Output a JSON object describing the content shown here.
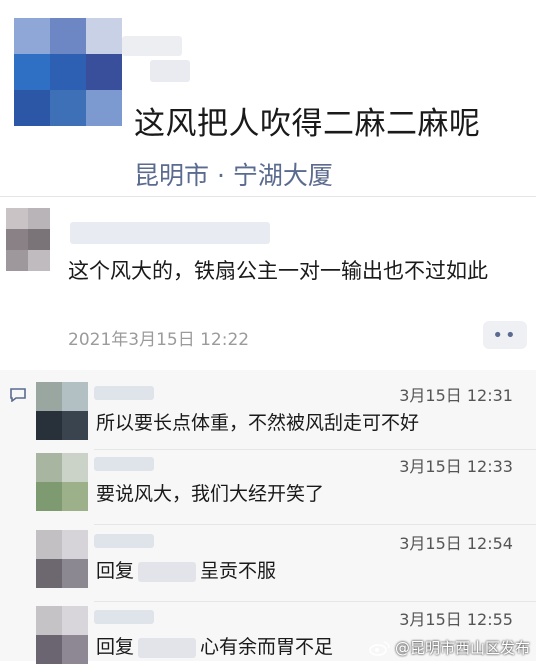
{
  "post": {
    "text": "这风把人吹得二麻二麻呢",
    "location": "昆明市 · 宁湖大厦"
  },
  "comment": {
    "text": "这个风大的，铁扇公主一对一输出也不过如此",
    "time": "2021年3月15日 12:22",
    "more_icon": "••"
  },
  "replies": [
    {
      "time": "3月15日 12:31",
      "text": "所以要长点体重，不然被风刮走可不好"
    },
    {
      "time": "3月15日 12:33",
      "text": "要说风大，我们大经开笑了"
    },
    {
      "time": "3月15日 12:54",
      "reply_prefix": "回复",
      "text": "呈贡不服"
    },
    {
      "time": "3月15日 12:55",
      "reply_prefix": "回复",
      "text": "心有余而胃不足"
    }
  ],
  "watermark": "@昆明市西山区发布",
  "colors": {
    "location_link": "#5a6b8f",
    "time_gray": "#9b9b9b",
    "reply_bg": "#f7f7f7"
  }
}
